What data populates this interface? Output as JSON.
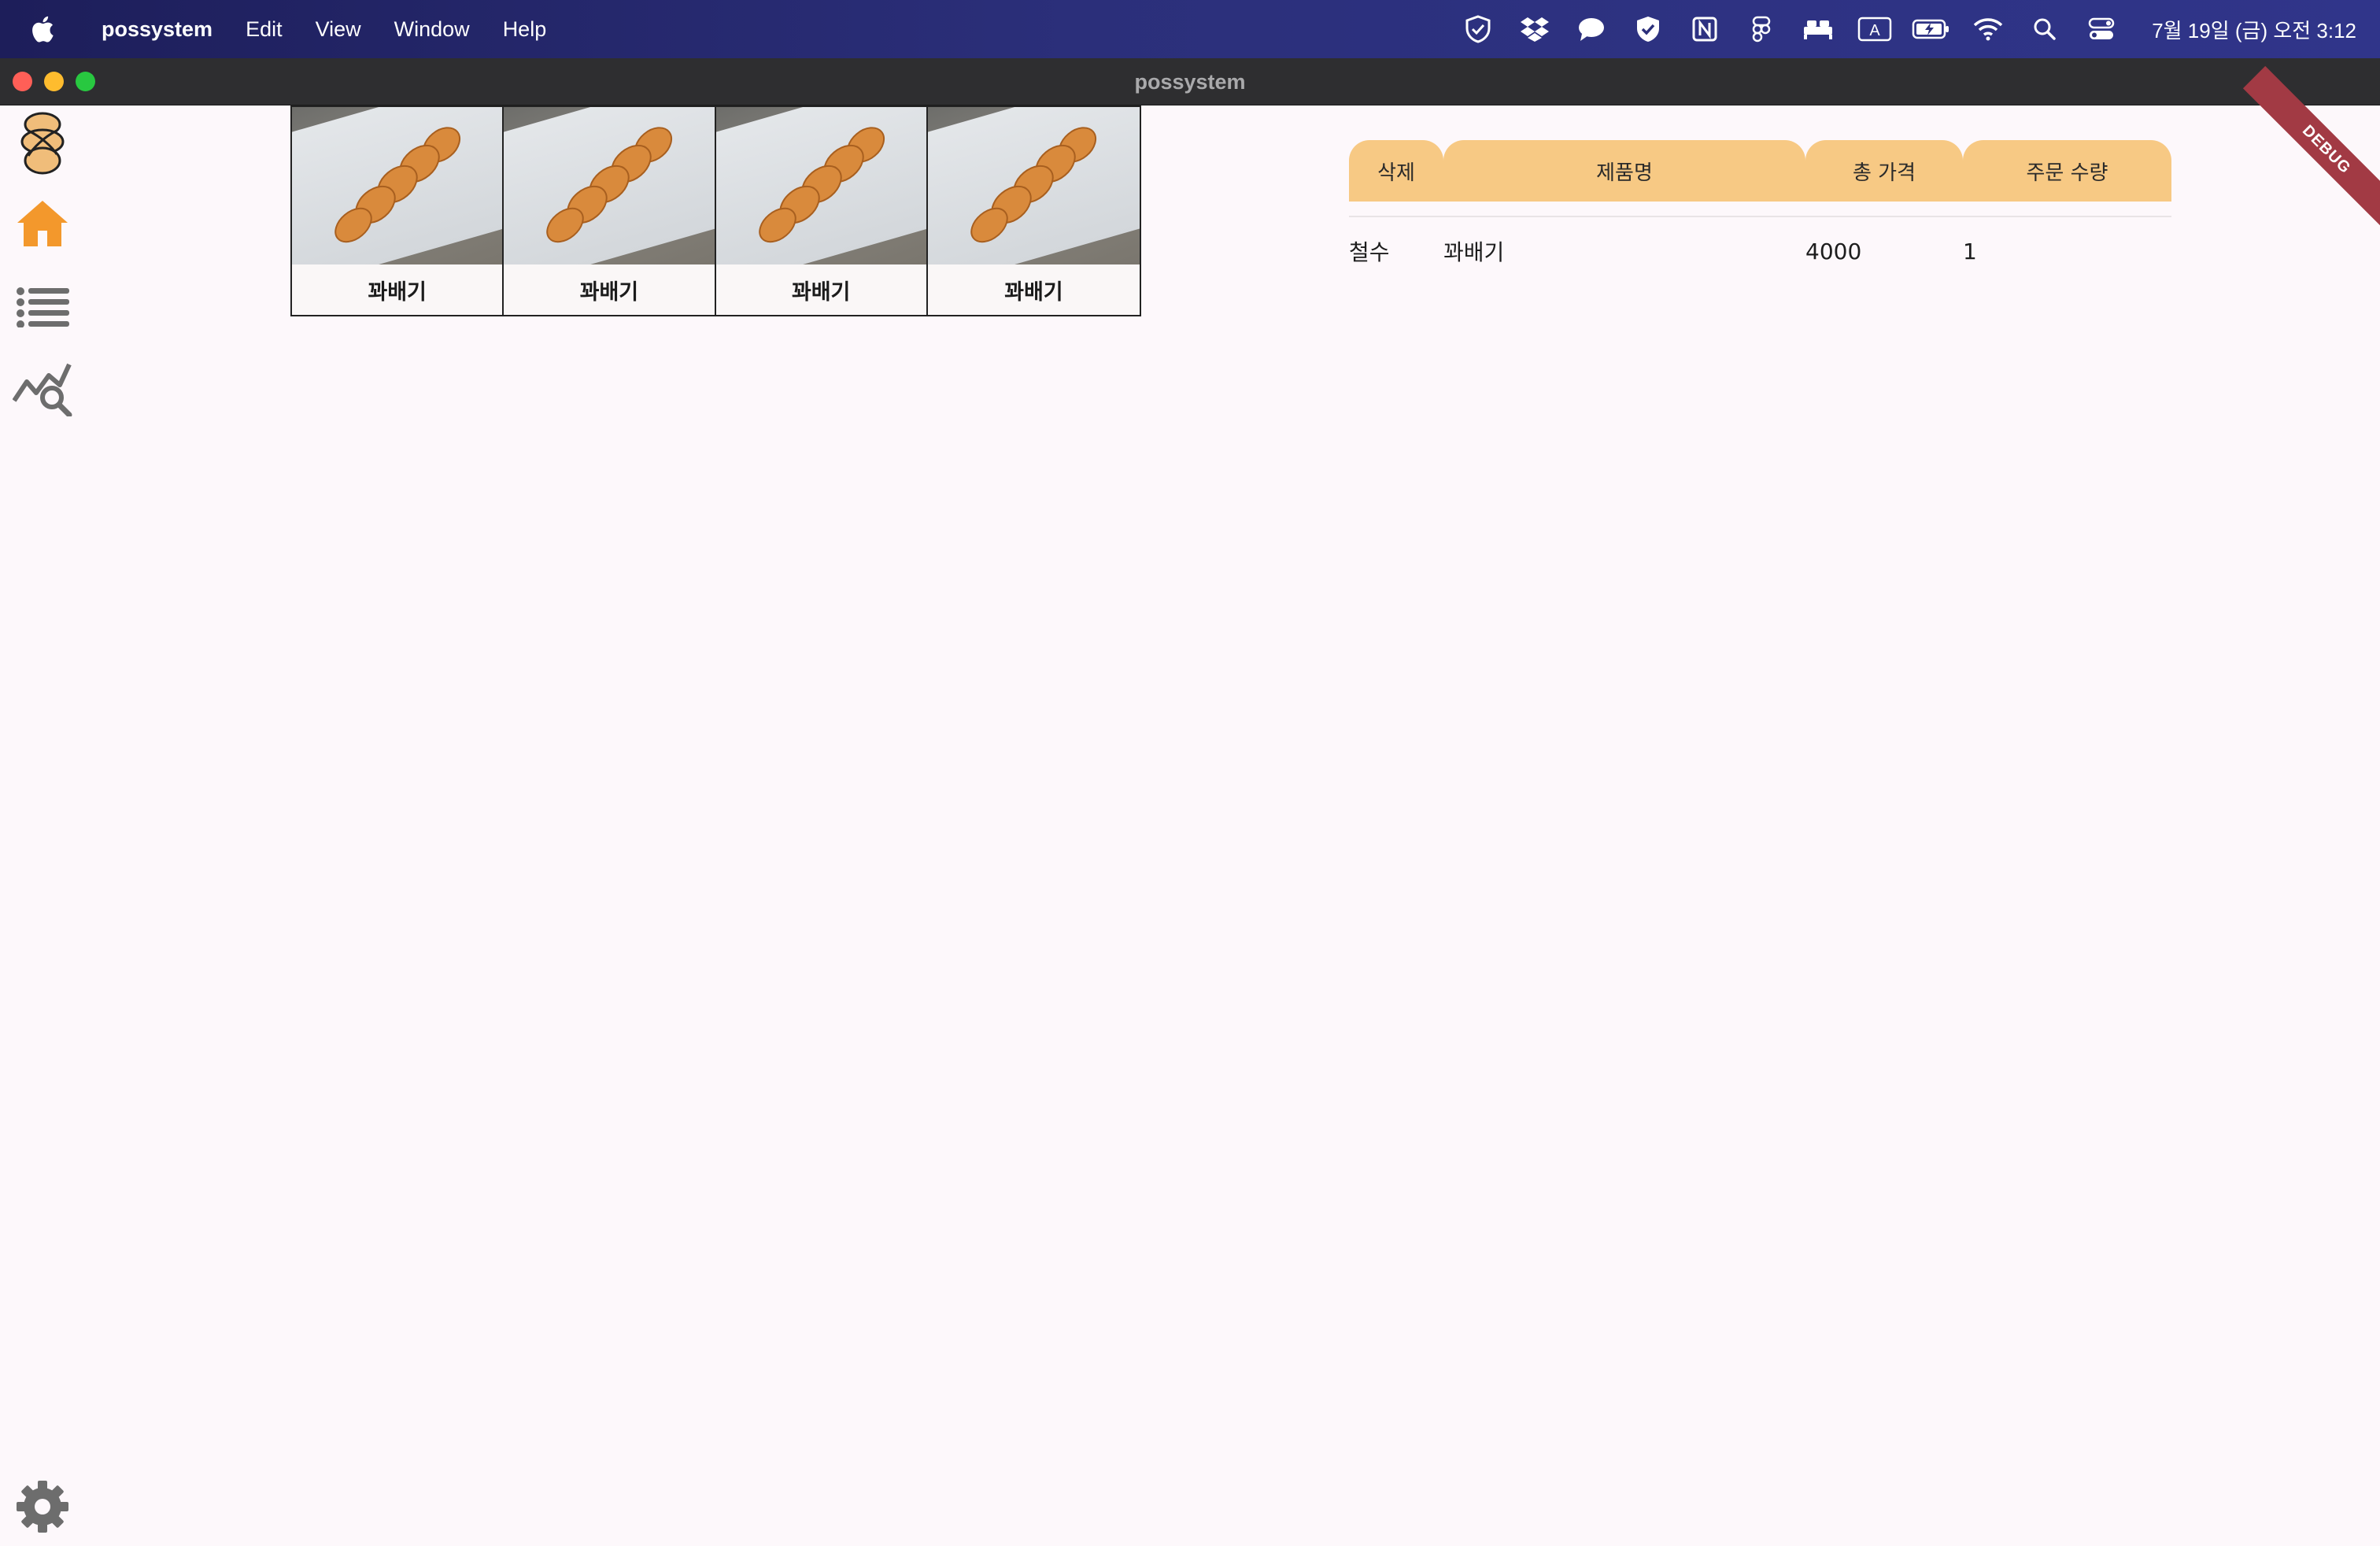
{
  "menubar": {
    "app_name": "possystem",
    "items": [
      "Edit",
      "View",
      "Window",
      "Help"
    ],
    "clock": "7월 19일 (금) 오전 3:12",
    "tray_icons": [
      "shield-icon",
      "dropbox-icon",
      "chat-icon",
      "shield-check-icon",
      "notion-icon",
      "figma-icon",
      "bed-icon",
      "input-source-icon",
      "battery-icon",
      "wifi-icon",
      "spotlight-icon",
      "control-center-icon"
    ],
    "input_source_label": "A"
  },
  "window": {
    "title": "possystem"
  },
  "sidebar": {
    "icons": [
      "logo-icon",
      "home-icon",
      "list-icon",
      "analytics-icon",
      "settings-icon"
    ],
    "accent": "#f3982c"
  },
  "products": [
    {
      "name": "꽈배기"
    },
    {
      "name": "꽈배기"
    },
    {
      "name": "꽈배기"
    },
    {
      "name": "꽈배기"
    }
  ],
  "order_table": {
    "headers": {
      "delete": "삭제",
      "name": "제품명",
      "total_price": "총 가격",
      "quantity": "주문 수량"
    },
    "rows": [
      {
        "delete": "철수",
        "name": "꽈배기",
        "total_price": "4000",
        "quantity": "1"
      }
    ],
    "header_color": "#f7c984"
  },
  "debug_banner": "DEBUG"
}
